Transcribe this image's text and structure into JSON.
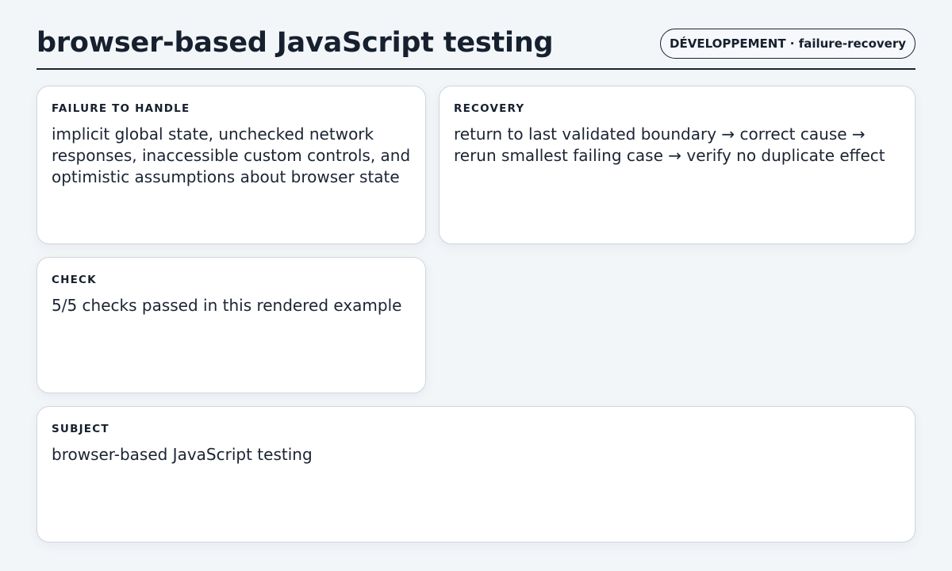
{
  "header": {
    "title": "browser-based JavaScript testing",
    "badge": "DÉVELOPPEMENT · failure-recovery"
  },
  "cards": {
    "failure": {
      "label": "FAILURE TO HANDLE",
      "body": "implicit global state, unchecked network responses, inaccessible custom controls, and optimistic assumptions about browser state"
    },
    "recovery": {
      "label": "RECOVERY",
      "body": "return to last validated boundary → correct cause → rerun smallest failing case → verify no duplicate effect"
    },
    "check": {
      "label": "CHECK",
      "body": "5/5 checks passed in this rendered example"
    },
    "subject": {
      "label": "SUBJECT",
      "body": "browser-based JavaScript testing"
    }
  },
  "colors": {
    "background": "#f3f6f9",
    "card": "#ffffff",
    "text": "#1b2433",
    "border": "#cfd6de"
  }
}
